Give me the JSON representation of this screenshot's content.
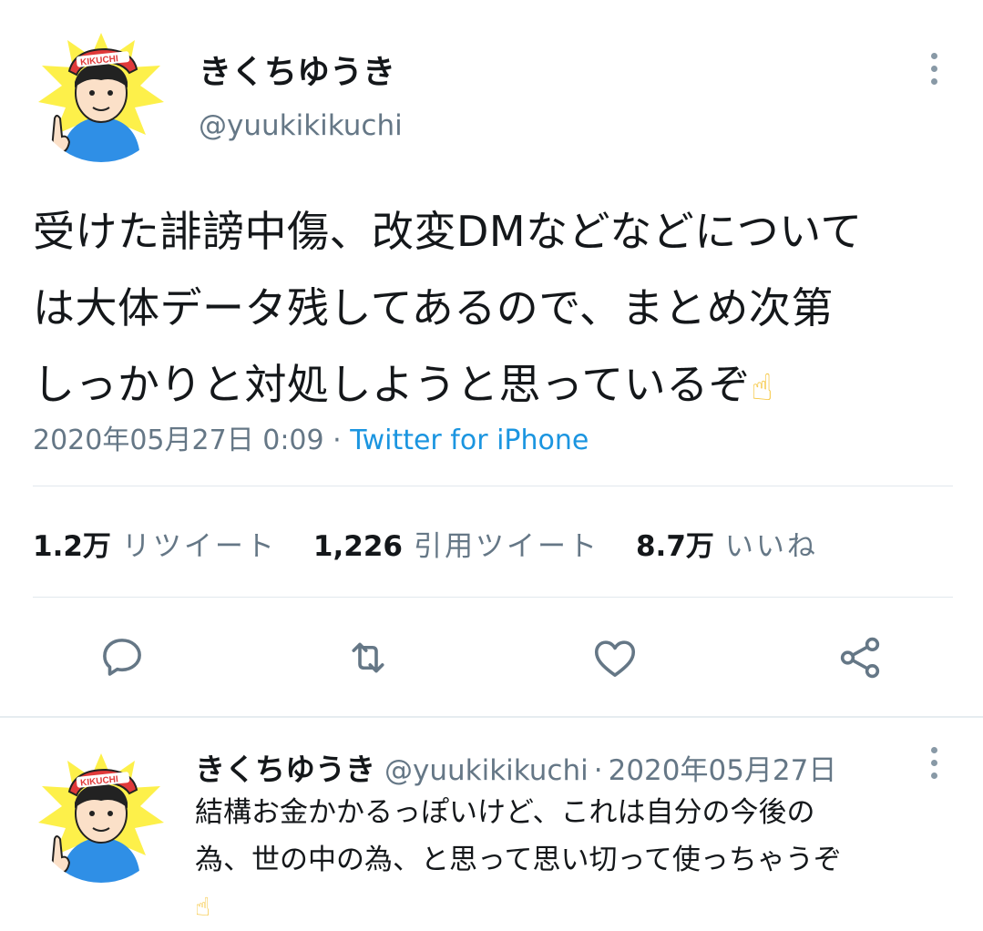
{
  "tweet": {
    "display_name": "きくちゆうき",
    "handle": "@yuukikikuchi",
    "avatar_cap_text": "KIKUCHI",
    "text_lines": [
      "受けた誹謗中傷、改変DMなどなどについて",
      "は大体データ残してあるので、まとめ次第",
      "しっかりと対処しようと思っているぞ"
    ],
    "emoji": "☝",
    "timestamp": "2020年05月27日 0:09",
    "separator": " · ",
    "source": "Twitter for iPhone",
    "stats": {
      "retweets_count": "1.2万",
      "retweets_label": "リツイート",
      "quotes_count": "1,226",
      "quotes_label": "引用ツイート",
      "likes_count": "8.7万",
      "likes_label": "いいね"
    },
    "actions": [
      "reply-icon",
      "retweet-icon",
      "like-icon",
      "share-icon"
    ]
  },
  "reply": {
    "display_name": "きくちゆうき",
    "handle": "@yuukikikuchi",
    "separator": "·",
    "date": "2020年05月27日",
    "avatar_cap_text": "KIKUCHI",
    "text_lines": [
      "結構お金かかるっぽいけど、これは自分の今後の",
      "為、世の中の為、と思って思い切って使っちゃうぞ"
    ],
    "emoji": "☝"
  },
  "colors": {
    "text": "#14171a",
    "secondary": "#657786",
    "link": "#1b95e0",
    "icon": "#657786",
    "divider": "#e1e8ed"
  }
}
